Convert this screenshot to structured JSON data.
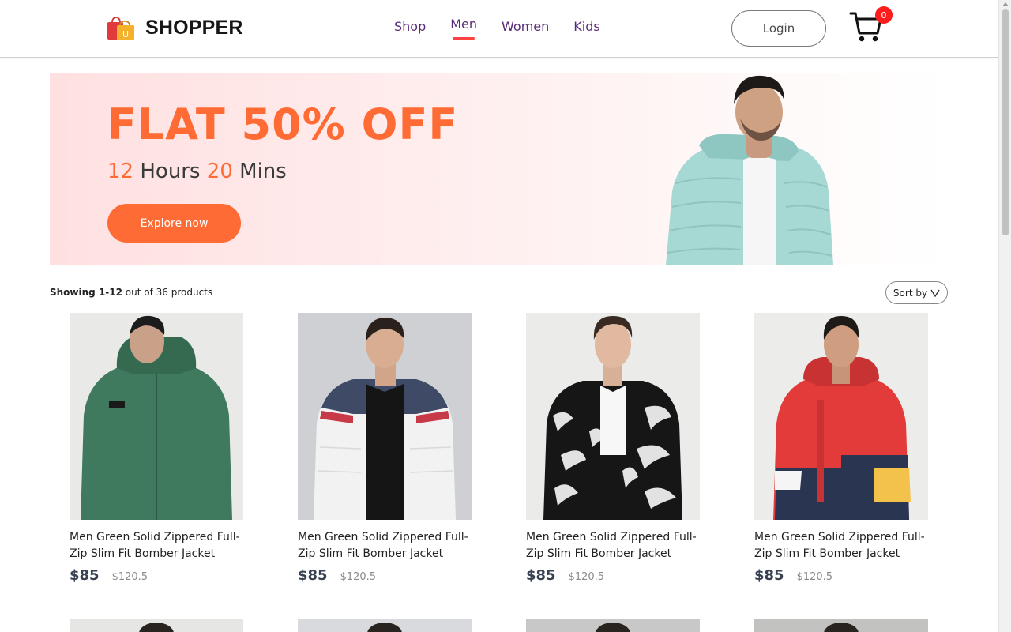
{
  "brand": {
    "name": "SHOPPER",
    "logo_icon": "shopping-bag-icon",
    "bag_letter": "U"
  },
  "nav": {
    "items": [
      {
        "label": "Shop",
        "active": false
      },
      {
        "label": "Men",
        "active": true
      },
      {
        "label": "Women",
        "active": false
      },
      {
        "label": "Kids",
        "active": false
      }
    ]
  },
  "header": {
    "login_label": "Login",
    "cart_count": "0",
    "cart_icon": "cart-icon"
  },
  "banner": {
    "title": "FLAT 50% OFF",
    "hours_value": "12",
    "hours_label": " Hours ",
    "mins_value": "20",
    "mins_label": " Mins",
    "button_label": "Explore now"
  },
  "listing": {
    "showing_range": "Showing 1-12",
    "showing_rest": " out of 36 products",
    "sort_label": "Sort by"
  },
  "products": [
    {
      "name": "Men Green Solid Zippered Full-Zip Slim Fit Bomber Jacket",
      "new_price": "$85",
      "old_price": "$120.5"
    },
    {
      "name": "Men Green Solid Zippered Full-Zip Slim Fit Bomber Jacket",
      "new_price": "$85",
      "old_price": "$120.5"
    },
    {
      "name": "Men Green Solid Zippered Full-Zip Slim Fit Bomber Jacket",
      "new_price": "$85",
      "old_price": "$120.5"
    },
    {
      "name": "Men Green Solid Zippered Full-Zip Slim Fit Bomber Jacket",
      "new_price": "$85",
      "old_price": "$120.5"
    }
  ],
  "colors": {
    "accent": "#ff6b35",
    "nav_text": "#5a2a7a",
    "active_underline": "#ff4141",
    "badge": "#ff1c1c"
  }
}
